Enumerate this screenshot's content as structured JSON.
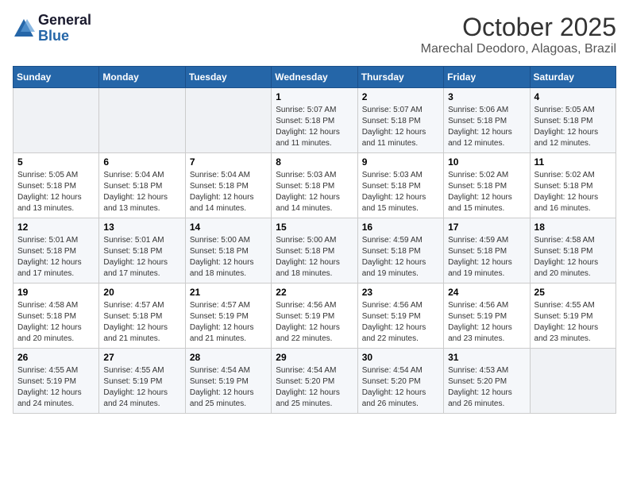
{
  "header": {
    "logo": {
      "line1": "General",
      "line2": "Blue"
    },
    "title": "October 2025",
    "subtitle": "Marechal Deodoro, Alagoas, Brazil"
  },
  "weekdays": [
    "Sunday",
    "Monday",
    "Tuesday",
    "Wednesday",
    "Thursday",
    "Friday",
    "Saturday"
  ],
  "weeks": [
    [
      {
        "day": "",
        "info": ""
      },
      {
        "day": "",
        "info": ""
      },
      {
        "day": "",
        "info": ""
      },
      {
        "day": "1",
        "info": "Sunrise: 5:07 AM\nSunset: 5:18 PM\nDaylight: 12 hours and 11 minutes."
      },
      {
        "day": "2",
        "info": "Sunrise: 5:07 AM\nSunset: 5:18 PM\nDaylight: 12 hours and 11 minutes."
      },
      {
        "day": "3",
        "info": "Sunrise: 5:06 AM\nSunset: 5:18 PM\nDaylight: 12 hours and 12 minutes."
      },
      {
        "day": "4",
        "info": "Sunrise: 5:05 AM\nSunset: 5:18 PM\nDaylight: 12 hours and 12 minutes."
      }
    ],
    [
      {
        "day": "5",
        "info": "Sunrise: 5:05 AM\nSunset: 5:18 PM\nDaylight: 12 hours and 13 minutes."
      },
      {
        "day": "6",
        "info": "Sunrise: 5:04 AM\nSunset: 5:18 PM\nDaylight: 12 hours and 13 minutes."
      },
      {
        "day": "7",
        "info": "Sunrise: 5:04 AM\nSunset: 5:18 PM\nDaylight: 12 hours and 14 minutes."
      },
      {
        "day": "8",
        "info": "Sunrise: 5:03 AM\nSunset: 5:18 PM\nDaylight: 12 hours and 14 minutes."
      },
      {
        "day": "9",
        "info": "Sunrise: 5:03 AM\nSunset: 5:18 PM\nDaylight: 12 hours and 15 minutes."
      },
      {
        "day": "10",
        "info": "Sunrise: 5:02 AM\nSunset: 5:18 PM\nDaylight: 12 hours and 15 minutes."
      },
      {
        "day": "11",
        "info": "Sunrise: 5:02 AM\nSunset: 5:18 PM\nDaylight: 12 hours and 16 minutes."
      }
    ],
    [
      {
        "day": "12",
        "info": "Sunrise: 5:01 AM\nSunset: 5:18 PM\nDaylight: 12 hours and 17 minutes."
      },
      {
        "day": "13",
        "info": "Sunrise: 5:01 AM\nSunset: 5:18 PM\nDaylight: 12 hours and 17 minutes."
      },
      {
        "day": "14",
        "info": "Sunrise: 5:00 AM\nSunset: 5:18 PM\nDaylight: 12 hours and 18 minutes."
      },
      {
        "day": "15",
        "info": "Sunrise: 5:00 AM\nSunset: 5:18 PM\nDaylight: 12 hours and 18 minutes."
      },
      {
        "day": "16",
        "info": "Sunrise: 4:59 AM\nSunset: 5:18 PM\nDaylight: 12 hours and 19 minutes."
      },
      {
        "day": "17",
        "info": "Sunrise: 4:59 AM\nSunset: 5:18 PM\nDaylight: 12 hours and 19 minutes."
      },
      {
        "day": "18",
        "info": "Sunrise: 4:58 AM\nSunset: 5:18 PM\nDaylight: 12 hours and 20 minutes."
      }
    ],
    [
      {
        "day": "19",
        "info": "Sunrise: 4:58 AM\nSunset: 5:18 PM\nDaylight: 12 hours and 20 minutes."
      },
      {
        "day": "20",
        "info": "Sunrise: 4:57 AM\nSunset: 5:18 PM\nDaylight: 12 hours and 21 minutes."
      },
      {
        "day": "21",
        "info": "Sunrise: 4:57 AM\nSunset: 5:19 PM\nDaylight: 12 hours and 21 minutes."
      },
      {
        "day": "22",
        "info": "Sunrise: 4:56 AM\nSunset: 5:19 PM\nDaylight: 12 hours and 22 minutes."
      },
      {
        "day": "23",
        "info": "Sunrise: 4:56 AM\nSunset: 5:19 PM\nDaylight: 12 hours and 22 minutes."
      },
      {
        "day": "24",
        "info": "Sunrise: 4:56 AM\nSunset: 5:19 PM\nDaylight: 12 hours and 23 minutes."
      },
      {
        "day": "25",
        "info": "Sunrise: 4:55 AM\nSunset: 5:19 PM\nDaylight: 12 hours and 23 minutes."
      }
    ],
    [
      {
        "day": "26",
        "info": "Sunrise: 4:55 AM\nSunset: 5:19 PM\nDaylight: 12 hours and 24 minutes."
      },
      {
        "day": "27",
        "info": "Sunrise: 4:55 AM\nSunset: 5:19 PM\nDaylight: 12 hours and 24 minutes."
      },
      {
        "day": "28",
        "info": "Sunrise: 4:54 AM\nSunset: 5:19 PM\nDaylight: 12 hours and 25 minutes."
      },
      {
        "day": "29",
        "info": "Sunrise: 4:54 AM\nSunset: 5:20 PM\nDaylight: 12 hours and 25 minutes."
      },
      {
        "day": "30",
        "info": "Sunrise: 4:54 AM\nSunset: 5:20 PM\nDaylight: 12 hours and 26 minutes."
      },
      {
        "day": "31",
        "info": "Sunrise: 4:53 AM\nSunset: 5:20 PM\nDaylight: 12 hours and 26 minutes."
      },
      {
        "day": "",
        "info": ""
      }
    ]
  ]
}
